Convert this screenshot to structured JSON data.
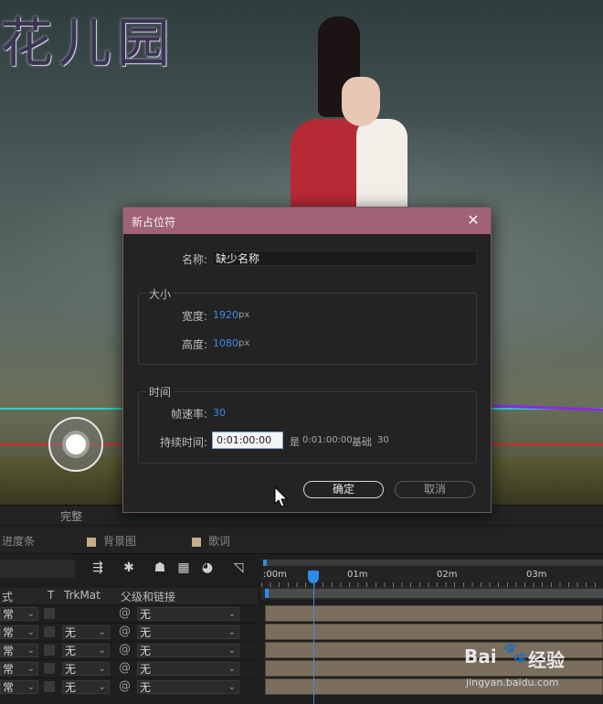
{
  "preview": {
    "logo_text": "花儿园"
  },
  "comp_bar": {
    "label": "完整"
  },
  "timeline": {
    "tabs": [
      {
        "label": "进度条"
      },
      {
        "label": "背景图"
      },
      {
        "label": "歌词"
      }
    ],
    "columns": {
      "mode": "式",
      "t": "T",
      "trkmat": "TrkMat",
      "parent": "父级和链接"
    },
    "ruler_labels": [
      ":00m",
      "01m",
      "02m",
      "03m"
    ],
    "rows": [
      {
        "mode": "常",
        "trkmat": "",
        "parent": "无"
      },
      {
        "mode": "常",
        "trkmat": "无",
        "parent": "无"
      },
      {
        "mode": "常",
        "trkmat": "无",
        "parent": "无"
      },
      {
        "mode": "常",
        "trkmat": "无",
        "parent": "无"
      },
      {
        "mode": "常",
        "trkmat": "无",
        "parent": "无"
      }
    ]
  },
  "dialog": {
    "title": "新占位符",
    "name_label": "名称:",
    "name_value": "缺少名称",
    "size_group": "大小",
    "width_label": "宽度:",
    "width_value": "1920",
    "height_label": "高度:",
    "height_value": "1080",
    "unit_px": "px",
    "time_group": "时间",
    "framerate_label": "帧速率:",
    "framerate_value": "30",
    "duration_label": "持续时间:",
    "duration_value": "0:01:00:00",
    "duration_is": "是",
    "duration_equals": "0:01:00:00",
    "base_label": "基础",
    "base_value": "30",
    "ok_label": "确定",
    "cancel_label": "取消"
  },
  "watermark": {
    "brand": "Bai",
    "brand_cn": "经验",
    "url": "jingyan.baidu.com"
  }
}
